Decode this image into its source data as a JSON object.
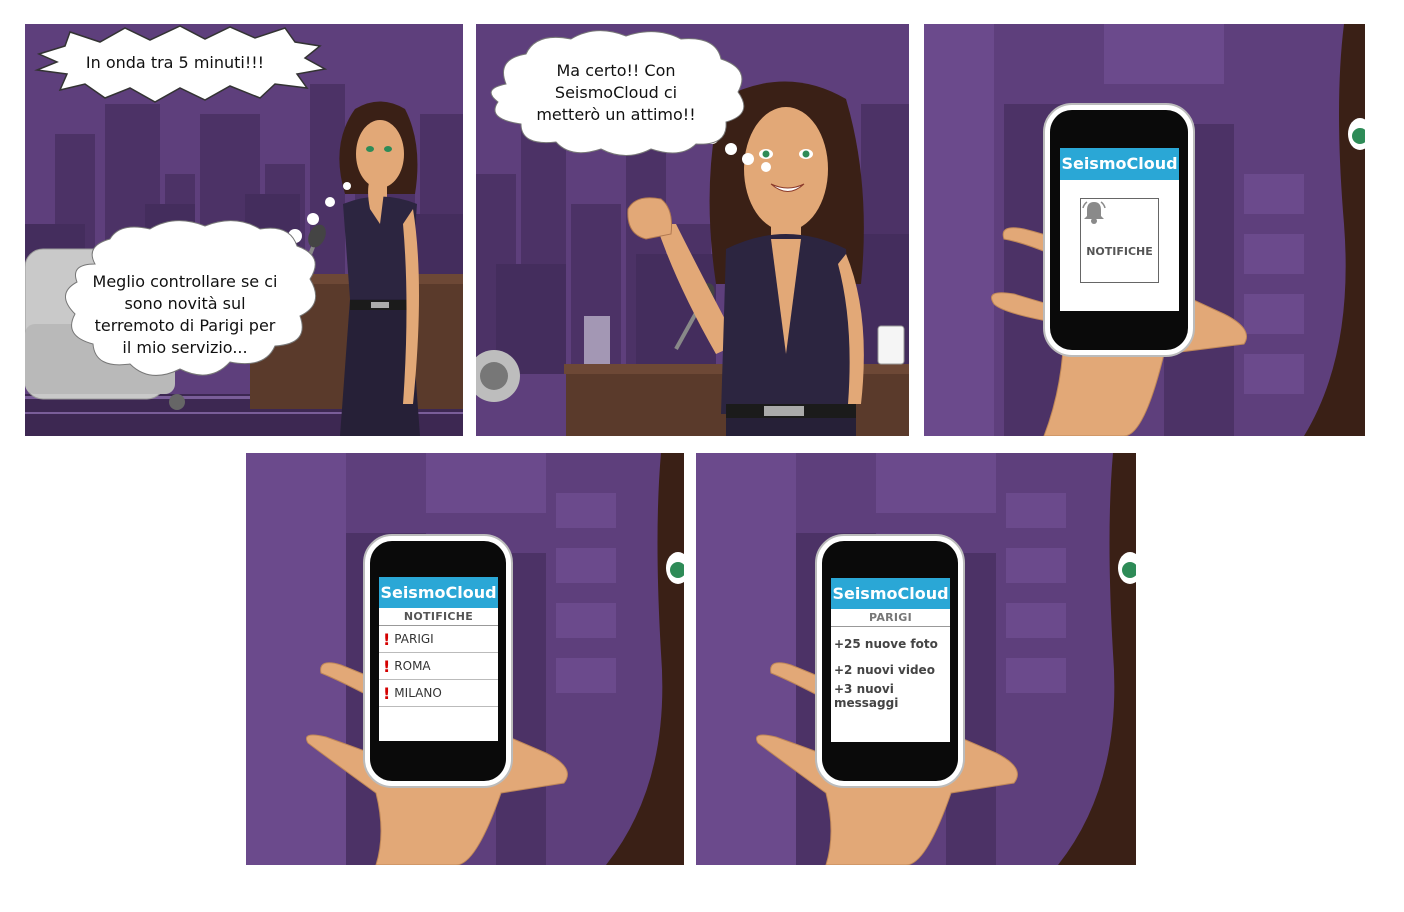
{
  "colors": {
    "bg_purple": "#5e3f7c",
    "app_blue": "#2aa7d6",
    "alert_red": "#d40000",
    "skin": "#e2a877"
  },
  "panel1": {
    "shout_bubble": "In onda tra 5 minuti!!!",
    "thought_bubble_lines": [
      "Meglio controllare se ci",
      "sono novità sul",
      "terremoto di Parigi per",
      "il mio servizio..."
    ]
  },
  "panel2": {
    "thought_bubble_lines": [
      "Ma certo!! Con",
      "SeismoCloud ci",
      "metterò un attimo!!"
    ]
  },
  "panel3": {
    "app_title": "SeismoCloud",
    "notifications_button": "NOTIFICHE",
    "notifications_icon": "bell-icon"
  },
  "panel4": {
    "app_title": "SeismoCloud",
    "section": "NOTIFICHE",
    "alert_marker": "!",
    "items": [
      "PARIGI",
      "ROMA",
      "MILANO"
    ]
  },
  "panel5": {
    "app_title": "SeismoCloud",
    "section": "PARIGI",
    "updates": [
      "+25 nuove foto",
      "+2 nuovi video",
      "+3 nuovi messaggi"
    ]
  }
}
